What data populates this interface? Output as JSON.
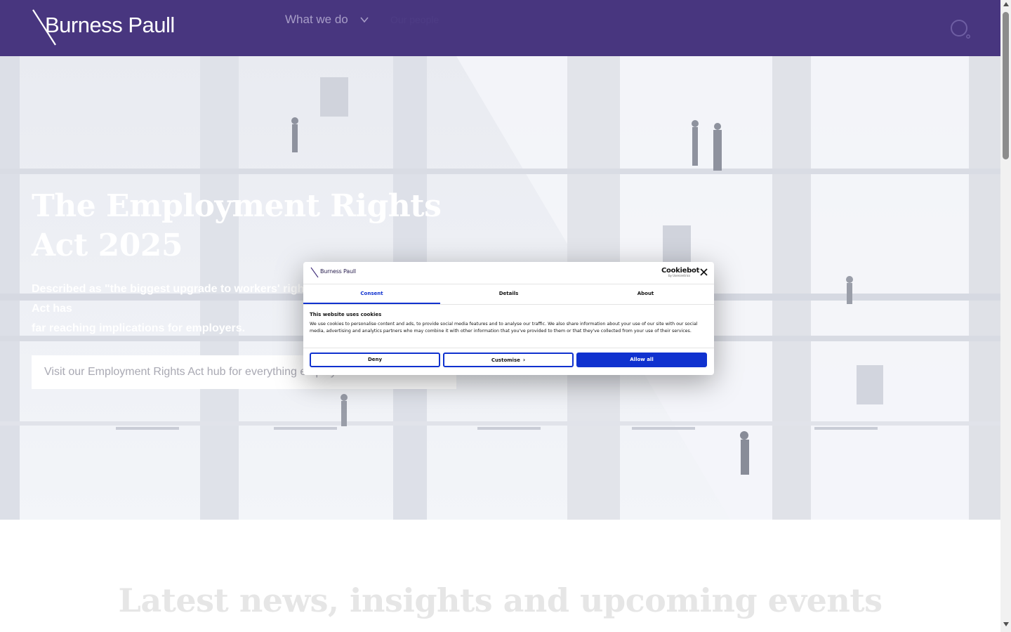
{
  "header": {
    "logo_text": "Burness Paull",
    "nav_what_we_do": "What we do",
    "nav_faded": "Our people"
  },
  "hero": {
    "title_line1": "The Employment Rights",
    "title_line2": "Act 2025",
    "description_line1": "Described as \"the biggest upgrade to workers' rights in a generation\" the new Act has",
    "description_line2": "far reaching implications for employers.",
    "cta_text": "Visit our Employment Rights Act hub for everything employers need to know"
  },
  "latest": {
    "title": "Latest news, insights and upcoming events"
  },
  "cookie_dialog": {
    "logo_text": "Burness Paull",
    "brand": "Cookiebot",
    "brand_sub": "by Usercentrics",
    "tabs": [
      "Consent",
      "Details",
      "About"
    ],
    "active_tab": "Consent",
    "heading": "This website uses cookies",
    "body": "We use cookies to personalise content and ads, to provide social media features and to analyse our traffic. We also share information about your use of our site with our social media, advertising and analytics partners who may combine it with other information that you've provided to them or that they've collected from your use of their services.",
    "buttons": {
      "deny": "Deny",
      "customise": "Customise",
      "allow_all": "Allow all"
    },
    "accent_color": "#1032cf"
  },
  "colors": {
    "header_bg": "#48367f",
    "accent": "#1032cf"
  },
  "icons": {
    "search": "search-icon",
    "close": "close-icon",
    "chevron": "chevron-down-icon"
  }
}
